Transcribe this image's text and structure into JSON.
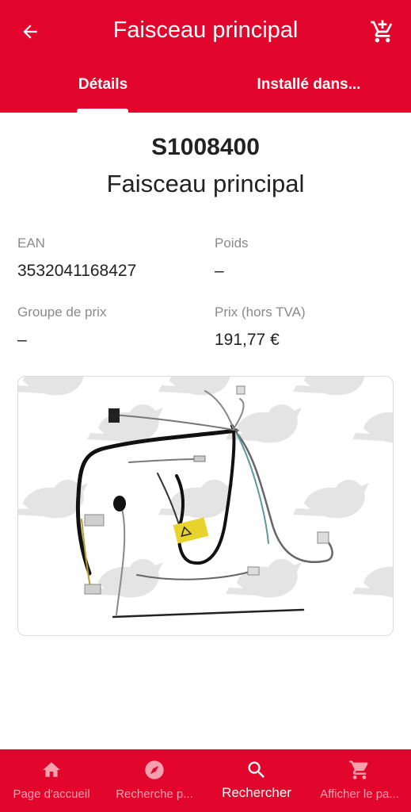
{
  "appbar": {
    "title": "Faisceau principal",
    "back_icon": "arrow-back-icon",
    "cart_icon": "cart-add-icon"
  },
  "tabs": [
    {
      "label": "Détails",
      "selected": true
    },
    {
      "label": "Installé dans...",
      "selected": false
    }
  ],
  "part": {
    "reference": "S1008400",
    "name": "Faisceau principal"
  },
  "specs": {
    "ean_label": "EAN",
    "ean_value": "3532041168427",
    "weight_label": "Poids",
    "weight_value": "–",
    "price_group_label": "Groupe de prix",
    "price_group_value": "–",
    "price_label": "Prix (hors TVA)",
    "price_value": "191,77 €"
  },
  "bottom_nav": [
    {
      "label": "Page d'accueil",
      "icon": "home-icon",
      "active": false
    },
    {
      "label": "Recherche p...",
      "icon": "compass-icon",
      "active": false
    },
    {
      "label": "Rechercher",
      "icon": "search-icon",
      "active": true
    },
    {
      "label": "Afficher le pa...",
      "icon": "cart-icon",
      "active": false
    }
  ],
  "colors": {
    "brand": "#e2062c",
    "text": "#222222",
    "label": "#8a8a8a"
  }
}
